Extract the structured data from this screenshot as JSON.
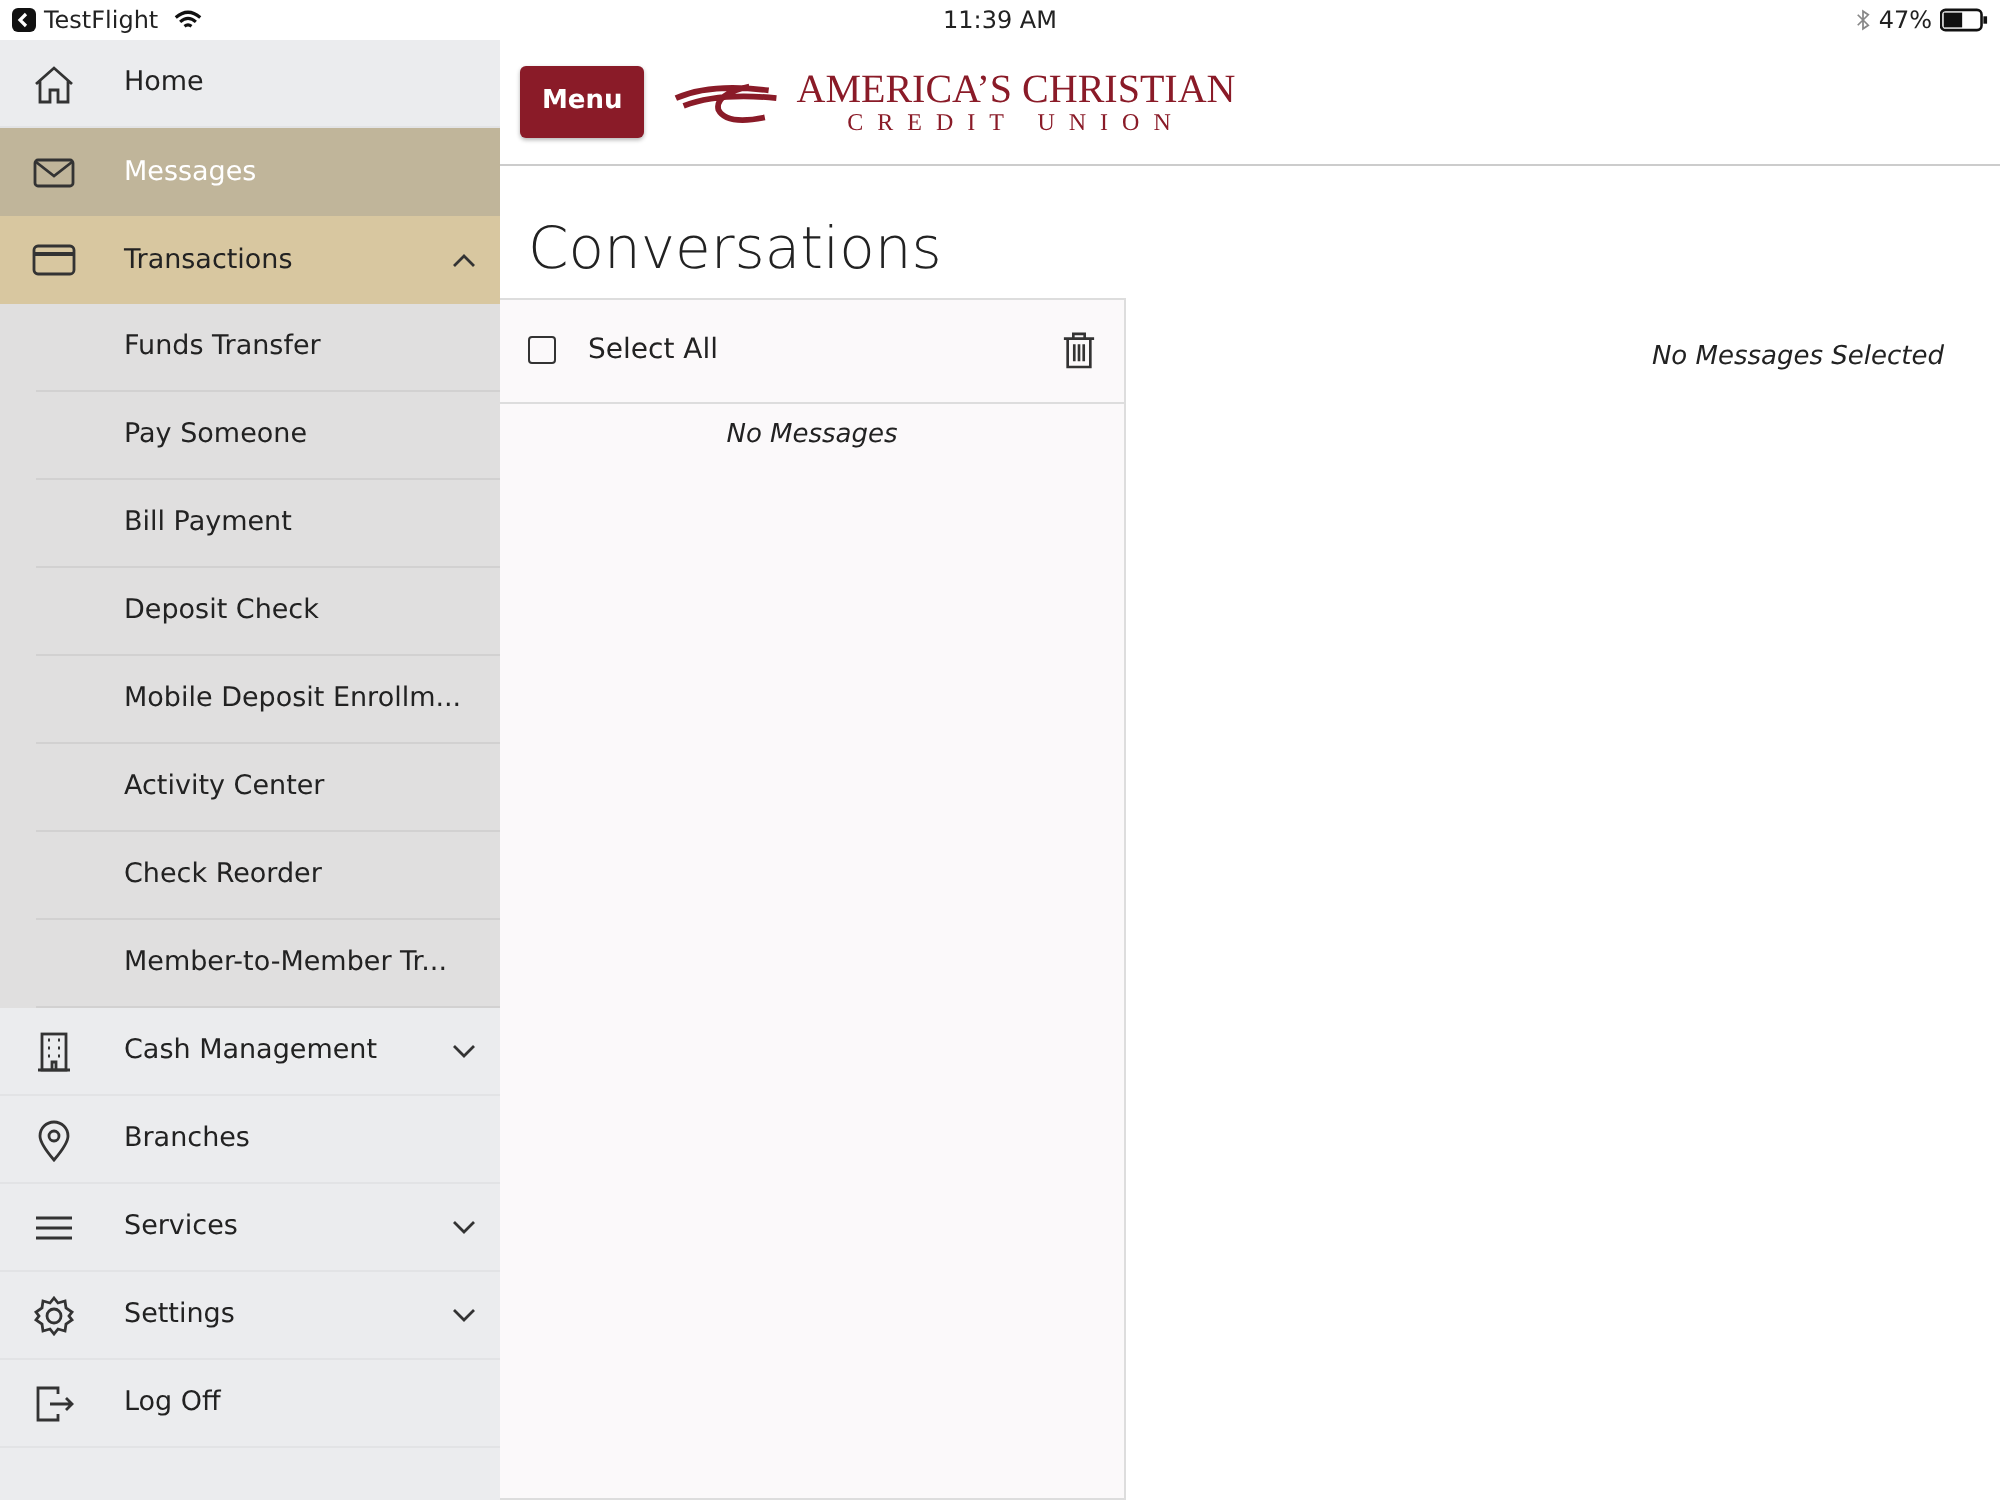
{
  "status_bar": {
    "back_app": "TestFlight",
    "time": "11:39 AM",
    "battery": "47%"
  },
  "sidebar": {
    "items": [
      {
        "label": "Home",
        "selected": false
      },
      {
        "label": "Messages",
        "selected": true
      },
      {
        "label": "Transactions",
        "selected": false,
        "expanded": true,
        "children": [
          {
            "label": "Funds Transfer"
          },
          {
            "label": "Pay Someone"
          },
          {
            "label": "Bill Payment"
          },
          {
            "label": "Deposit Check"
          },
          {
            "label": "Mobile Deposit Enrollm..."
          },
          {
            "label": "Activity Center"
          },
          {
            "label": "Check Reorder"
          },
          {
            "label": "Member-to-Member Tr..."
          }
        ]
      },
      {
        "label": "Cash Management",
        "selected": false,
        "expanded": false
      },
      {
        "label": "Branches",
        "selected": false
      },
      {
        "label": "Services",
        "selected": false,
        "expanded": false
      },
      {
        "label": "Settings",
        "selected": false,
        "expanded": false
      },
      {
        "label": "Log Off",
        "selected": false
      }
    ]
  },
  "header": {
    "menu_button": "Menu",
    "logo_line_1": "AMERICA’S CHRISTIAN",
    "logo_line_2": "CREDIT UNION"
  },
  "conversations": {
    "title": "Conversations",
    "select_all": {
      "label": "Select All",
      "checked": false
    },
    "empty_text": "No Messages"
  },
  "detail": {
    "empty_text": "No Messages Selected"
  }
}
